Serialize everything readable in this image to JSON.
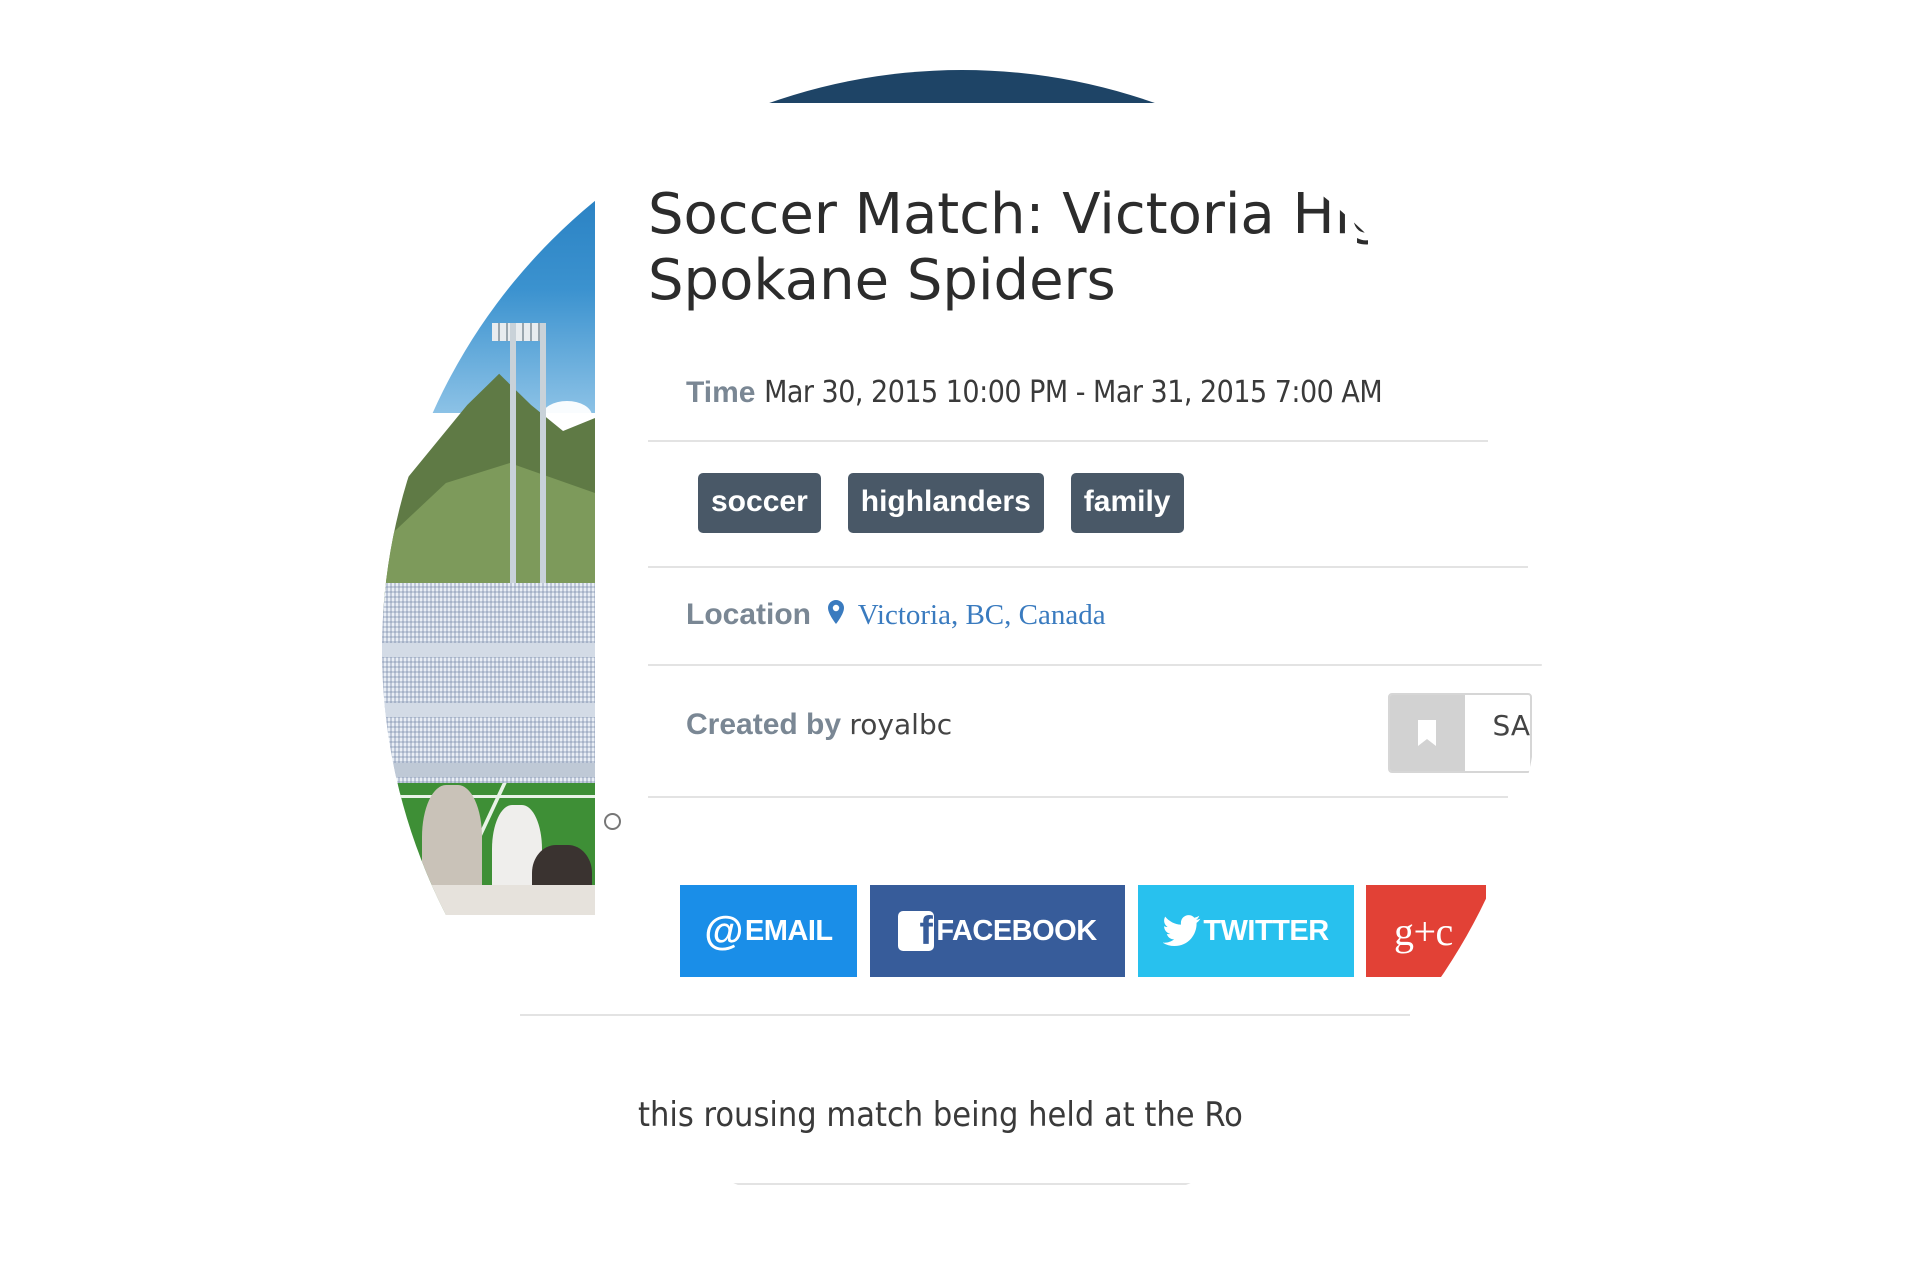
{
  "event": {
    "title_line1": "Soccer Match: Victoria Hig",
    "title_line2": "Spokane Spiders",
    "time_label": "Time",
    "time_value": "Mar 30, 2015 10:00 PM - Mar 31, 2015 7:00 AM",
    "tags": [
      "soccer",
      "highlanders",
      "family"
    ],
    "location_label": "Location",
    "location_value": "Victoria, BC, Canada",
    "created_label": "Created by",
    "created_value": "royalbc",
    "save_label": "SA",
    "description_snippet": "this rousing match being held at the Ro"
  },
  "share": {
    "email_glyph": "@",
    "email_label": "EMAIL",
    "facebook_glyph": "f",
    "facebook_label": "FACEBOOK",
    "twitter_label": "TWITTER",
    "googleplus_label": "g+c"
  },
  "icons": {
    "location": "map-pin-icon",
    "bookmark": "bookmark-icon",
    "twitter": "twitter-bird-icon",
    "facebook": "facebook-f-icon"
  },
  "colors": {
    "tag_bg": "#495867",
    "email": "#1a8ee8",
    "facebook": "#375c9a",
    "twitter": "#28c1ee",
    "googleplus": "#e24136",
    "link": "#3a7bbf",
    "header_band": "#1e4466"
  }
}
